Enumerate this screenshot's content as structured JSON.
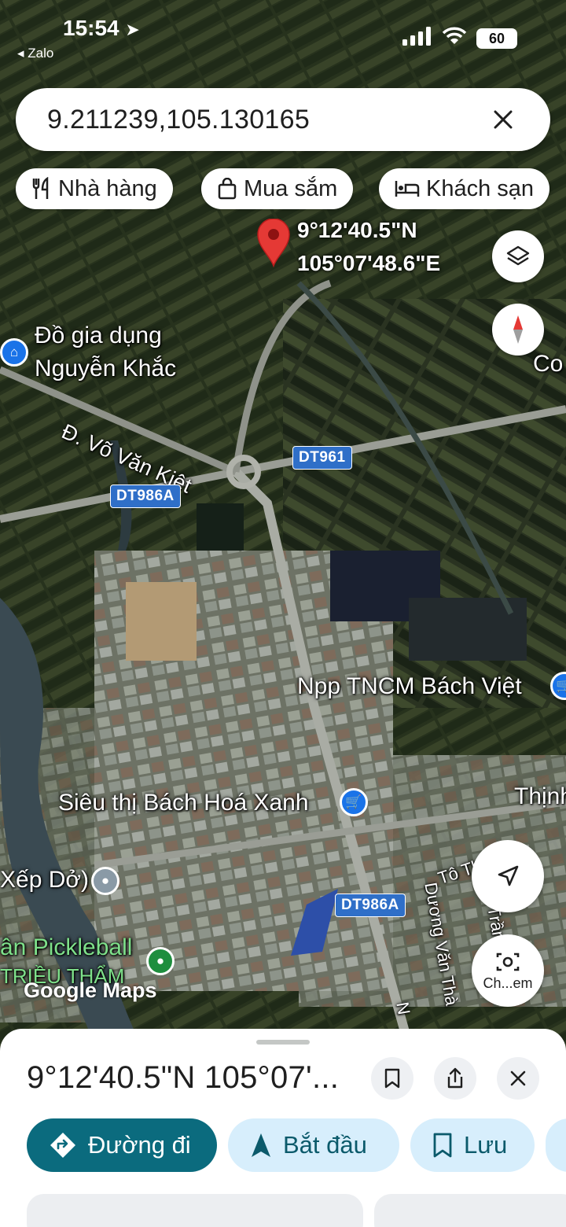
{
  "status_bar": {
    "time": "15:54",
    "back_app": "Zalo",
    "battery": "60"
  },
  "search": {
    "value": "9.211239,105.130165"
  },
  "chips": [
    {
      "label": "Nhà hàng",
      "icon": "restaurant-icon"
    },
    {
      "label": "Mua sắm",
      "icon": "shopping-bag-icon"
    },
    {
      "label": "Khách sạn",
      "icon": "hotel-bed-icon"
    }
  ],
  "marker": {
    "lat": "9°12'40.5\"N",
    "lng": "105°07'48.6\"E"
  },
  "map_labels": {
    "poi_do_gia_dung_line1": "Đồ gia dụng",
    "poi_do_gia_dung_line2": "Nguyễn Khắc",
    "street_vo_van_kiet": "Đ. Võ Văn Kiệt",
    "road_dt961": "DT961",
    "road_dt986a_top": "DT986A",
    "road_dt986a_bottom": "DT986A",
    "poi_npp": "Npp TNCM Bách Việt",
    "poi_sieu_thi": "Siêu thị Bách Hoá Xanh",
    "poi_xep_do": "Xếp Dở)",
    "poi_pickleball": "ân Pickleball",
    "poi_trieu_tham": "TRIỀU THẨM",
    "edge_co": "Co",
    "edge_thinh": "Thịnh",
    "street_duong_van_tha": "Dương Văn Thà",
    "street_to_thi": "Tô Thị T",
    "street_tran": "Trần",
    "street_n": "N",
    "google_logo": "Google Maps"
  },
  "fabs": {
    "camera_caption": "Ch...em"
  },
  "sheet": {
    "title": "9°12'40.5\"N 105°07'...",
    "actions": [
      {
        "label": "Đường đi",
        "icon": "directions-icon"
      },
      {
        "label": "Bắt đầu",
        "icon": "navigation-arrow-icon"
      },
      {
        "label": "Lưu",
        "icon": "bookmark-icon"
      }
    ]
  },
  "colors": {
    "primary": "#0b6b7e",
    "secondary_bg": "#d7eefc",
    "marker_red": "#e53935",
    "road_shield": "#2f6fc8"
  }
}
